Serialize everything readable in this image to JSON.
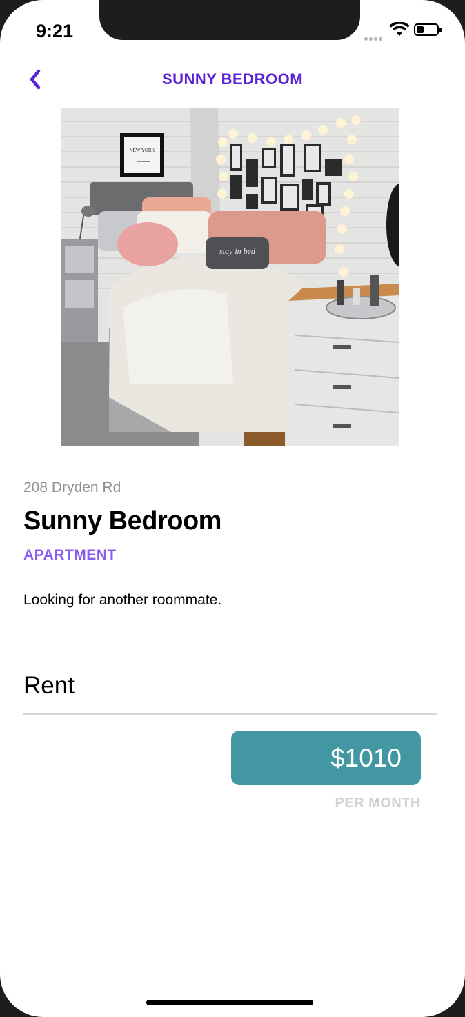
{
  "status_bar": {
    "time": "9:21"
  },
  "nav": {
    "title": "SUNNY BEDROOM"
  },
  "listing": {
    "address": "208 Dryden Rd",
    "title": "Sunny Bedroom",
    "type": "APARTMENT",
    "description": "Looking for another roommate.",
    "photo_wall_text": "NEW YORK",
    "pillow_text": "stay in bed"
  },
  "rent": {
    "heading": "Rent",
    "price": "$1010",
    "period": "PER MONTH"
  },
  "colors": {
    "accent": "#5b21d6",
    "type_label": "#8a5cf0",
    "price_button": "#4397a3"
  },
  "icons": {
    "back": "chevron-left-icon",
    "signal": "signal-icon",
    "wifi": "wifi-icon",
    "battery": "battery-icon"
  }
}
